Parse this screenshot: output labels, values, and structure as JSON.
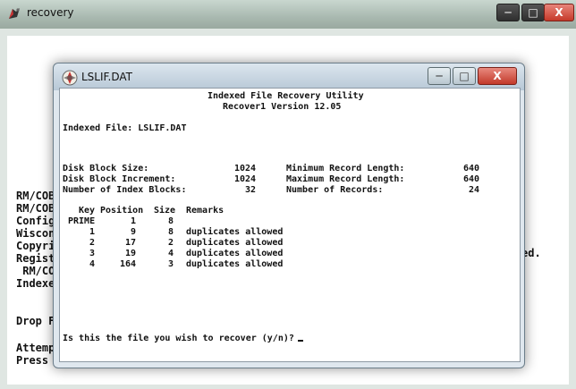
{
  "outer_window": {
    "title": "recovery",
    "lines_left": [
      "RM/COB",
      "RM/COB",
      "Config",
      "Wiscon",
      "Copyri",
      "Regist",
      " RM/CO",
      "Indexe",
      "",
      "Drop F",
      "",
      "Attemp"
    ],
    "line_right": "ed.",
    "bottom_line": "Press RETURN when ready..."
  },
  "inner_window": {
    "title": "LSLIF.DAT",
    "header_line1": "Indexed File Recovery Utility",
    "header_line2": "Recover1 Version 12.05",
    "indexed_file": "Indexed File: LSLIF.DAT",
    "stats": {
      "disk_block_size_label": "Disk Block Size:",
      "disk_block_size_value": "1024",
      "disk_block_increment_label": "Disk Block Increment:",
      "disk_block_increment_value": "1024",
      "number_index_blocks_label": "Number of Index Blocks:",
      "number_index_blocks_value": "32",
      "min_record_label": "Minimum Record Length:",
      "min_record_value": "640",
      "max_record_label": "Maximum Record Length:",
      "max_record_value": "640",
      "number_records_label": "Number of Records:",
      "number_records_value": "24"
    },
    "table": {
      "headers": [
        "Key",
        "Position",
        "Size",
        "Remarks"
      ],
      "rows": [
        [
          "PRIME",
          "1",
          "8",
          ""
        ],
        [
          "1",
          "9",
          "8",
          "duplicates allowed"
        ],
        [
          "2",
          "17",
          "2",
          "duplicates allowed"
        ],
        [
          "3",
          "19",
          "4",
          "duplicates allowed"
        ],
        [
          "4",
          "164",
          "3",
          "duplicates allowed"
        ]
      ]
    },
    "prompt": "Is this the file you wish to recover (y/n)?"
  },
  "colors": {
    "close_red": "#c53a2a",
    "console_bg": "#ffffff",
    "text": "#111111"
  },
  "icons": {
    "outer": "recovery-app-icon",
    "inner": "lslif-file-icon"
  }
}
